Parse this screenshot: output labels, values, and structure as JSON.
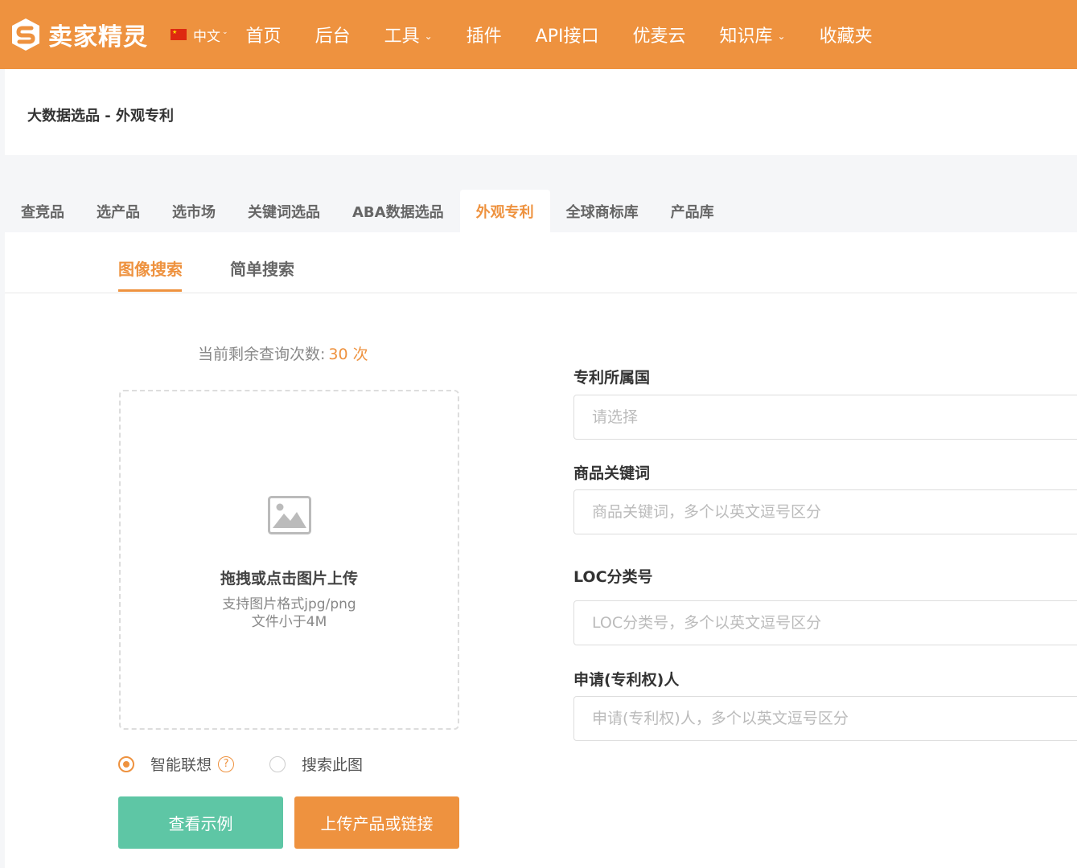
{
  "brand": {
    "name": "卖家精灵",
    "accent": "#ee923f"
  },
  "lang": {
    "label": "中文"
  },
  "nav": {
    "items": [
      {
        "label": "首页",
        "caret": false
      },
      {
        "label": "后台",
        "caret": false
      },
      {
        "label": "工具",
        "caret": true
      },
      {
        "label": "插件",
        "caret": false
      },
      {
        "label": "API接口",
        "caret": false
      },
      {
        "label": "优麦云",
        "caret": false
      },
      {
        "label": "知识库",
        "caret": true
      },
      {
        "label": "收藏夹",
        "caret": false
      }
    ]
  },
  "breadcrumb": "大数据选品 - 外观专利",
  "tabs": [
    {
      "label": "查竞品",
      "active": false
    },
    {
      "label": "选产品",
      "active": false
    },
    {
      "label": "选市场",
      "active": false
    },
    {
      "label": "关键词选品",
      "active": false
    },
    {
      "label": "ABA数据选品",
      "active": false
    },
    {
      "label": "外观专利",
      "active": true
    },
    {
      "label": "全球商标库",
      "active": false
    },
    {
      "label": "产品库",
      "active": false
    }
  ],
  "subtabs": [
    {
      "label": "图像搜索",
      "active": true
    },
    {
      "label": "简单搜索",
      "active": false
    }
  ],
  "quota": {
    "label": "当前剩余查询次数:",
    "value": "30 次"
  },
  "dropzone": {
    "icon": "image-placeholder-icon",
    "title": "拖拽或点击图片上传",
    "hint1": "支持图片格式jpg/png",
    "hint2": "文件小于4M"
  },
  "radios": {
    "smart": {
      "label": "智能联想",
      "checked": true,
      "help": "?"
    },
    "this_image": {
      "label": "搜索此图",
      "checked": false
    }
  },
  "buttons": {
    "example": "查看示例",
    "upload": "上传产品或链接"
  },
  "form": {
    "country": {
      "label": "专利所属国",
      "placeholder": "请选择"
    },
    "keyword": {
      "label": "商品关键词",
      "placeholder": "商品关键词，多个以英文逗号区分"
    },
    "loc": {
      "label": "LOC分类号",
      "placeholder": "LOC分类号，多个以英文逗号区分"
    },
    "applicant": {
      "label": "申请(专利权)人",
      "placeholder": "申请(专利权)人，多个以英文逗号区分"
    }
  }
}
